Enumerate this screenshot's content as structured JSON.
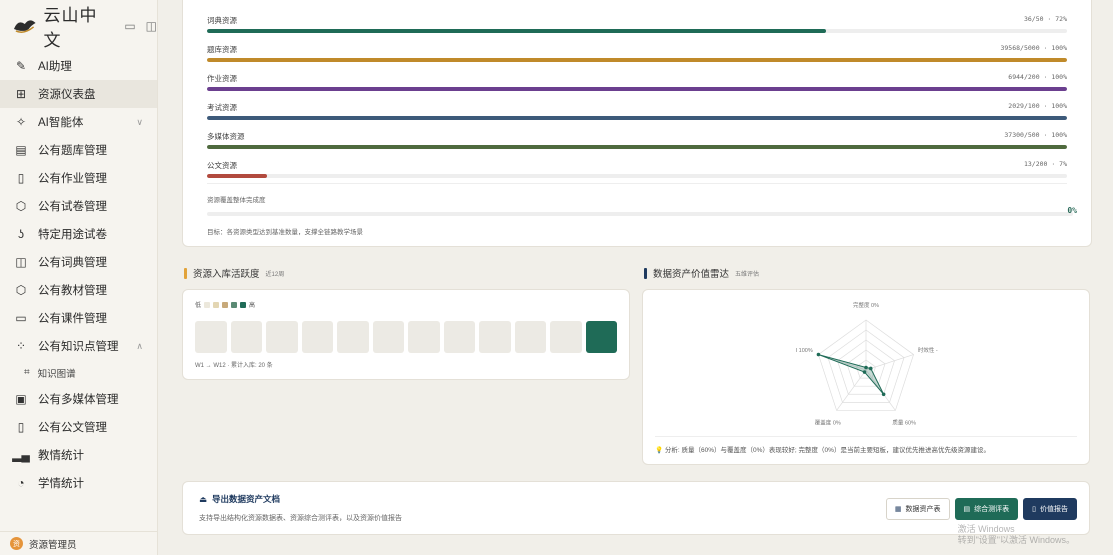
{
  "sidebar": {
    "brand_title": "云山中文",
    "nav": [
      {
        "label": "AI助理",
        "icon": "edit-icon"
      },
      {
        "label": "资源仪表盘",
        "icon": "dashboard-grid-icon"
      },
      {
        "label": "AI智能体",
        "icon": "sparkle-icon"
      },
      {
        "label": "公有题库管理",
        "icon": "clipboard-icon"
      },
      {
        "label": "公有作业管理",
        "icon": "document-icon"
      },
      {
        "label": "公有试卷管理",
        "icon": "shield-icon"
      },
      {
        "label": "特定用途试卷",
        "icon": "hook-icon"
      },
      {
        "label": "公有词典管理",
        "icon": "book-icon"
      },
      {
        "label": "公有教材管理",
        "icon": "shield-icon"
      },
      {
        "label": "公有课件管理",
        "icon": "monitor-icon"
      },
      {
        "label": "公有知识点管理",
        "icon": "nodes-icon"
      },
      {
        "label": "知识图谱",
        "icon": "graph-icon"
      },
      {
        "label": "公有多媒体管理",
        "icon": "image-icon"
      },
      {
        "label": "公有公文管理",
        "icon": "file-icon"
      },
      {
        "label": "教情统计",
        "icon": "bar-chart-icon"
      },
      {
        "label": "学情统计",
        "icon": "pie-icon"
      }
    ],
    "user_name": "资源管理员",
    "user_avatar": "资"
  },
  "resources": [
    {
      "label": "词典资源",
      "value": "36/50 · 72%",
      "percent": 72,
      "color": "#1f6b57"
    },
    {
      "label": "题库资源",
      "value": "39568/5000 · 100%",
      "percent": 100,
      "color": "#c08a2a"
    },
    {
      "label": "作业资源",
      "value": "6944/200 · 100%",
      "percent": 100,
      "color": "#6b3f8f"
    },
    {
      "label": "考试资源",
      "value": "2029/100 · 100%",
      "percent": 100,
      "color": "#3d5a7a"
    },
    {
      "label": "多媒体资源",
      "value": "37300/500 · 100%",
      "percent": 100,
      "color": "#4f6a3e"
    },
    {
      "label": "公文资源",
      "value": "13/200 · 7%",
      "percent": 7,
      "color": "#b24a3e"
    }
  ],
  "overall": {
    "title": "资源覆盖整体完成度",
    "percent_text": "0%",
    "percent": 0,
    "goal": "目标：各资源类型达到基准数量，支撑全链路教学场景"
  },
  "activity": {
    "title": "资源入库活跃度",
    "subtitle": "近12周",
    "legend_low": "低",
    "legend_high": "高",
    "legend_colors": [
      "#ece8dc",
      "#e3d6b3",
      "#c7a97a",
      "#5b8a74",
      "#1f6b57"
    ],
    "weeks": [
      0,
      0,
      0,
      0,
      0,
      0,
      0,
      0,
      0,
      0,
      0,
      20
    ],
    "note": "W1 → W12 · 累计入库: 20 条"
  },
  "radar": {
    "title": "数据资产价值雷达",
    "subtitle": "五维评估",
    "axes": [
      {
        "label": "完整度 0%",
        "value": 0
      },
      {
        "label": "时效性 -",
        "value": 0.1
      },
      {
        "label": "质量 60%",
        "value": 0.6
      },
      {
        "label": "覆盖度 0%",
        "value": 0
      },
      {
        "label": "I 100%",
        "value": 1.0
      }
    ],
    "analysis_prefix": "分析:",
    "analysis": "质量（60%）与覆盖度（0%）表现较好; 完整度（0%）是当前主要短板，建议优先推进高优先级资源建设。"
  },
  "export": {
    "title": "导出数据资产文档",
    "subtitle": "支持导出结构化资源数据表、资源综合测评表，以及资源价值报告",
    "buttons": [
      {
        "label": "数据资产表",
        "icon": "table-icon"
      },
      {
        "label": "综合测评表",
        "icon": "report-icon"
      },
      {
        "label": "价值报告",
        "icon": "doc-icon"
      }
    ]
  },
  "watermark": {
    "line1": "激活 Windows",
    "line2": "转到\"设置\"以激活 Windows。"
  },
  "colors": {
    "accent_green": "#1f6b57",
    "accent_navy": "#1f3a5f",
    "accent_gold": "#e2a33a"
  }
}
